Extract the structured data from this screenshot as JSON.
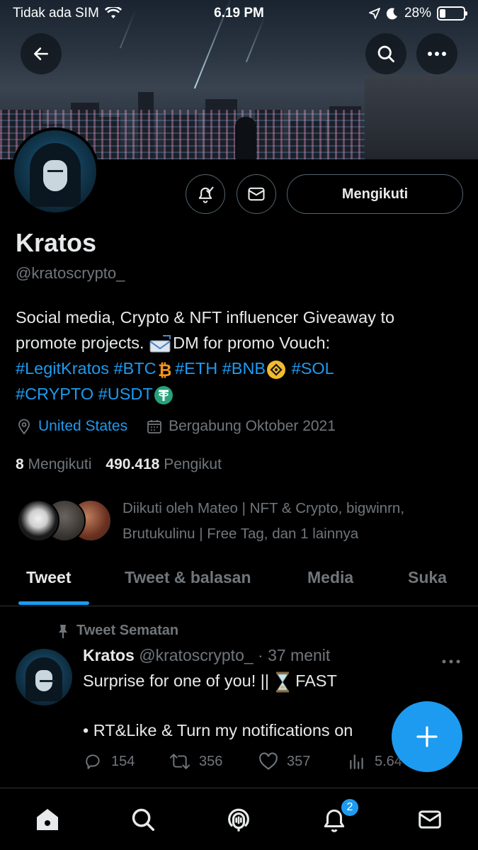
{
  "status_bar": {
    "carrier": "Tidak ada SIM",
    "time": "6.19 PM",
    "battery": "28%"
  },
  "profile": {
    "name": "Kratos",
    "handle": "@kratoscrypto_",
    "follow_button_label": "Mengikuti",
    "bio": {
      "line1": "Social media, Crypto & NFT influencer Giveaway to",
      "line2_text": "promote projects. ",
      "line2_rest": "DM for promo Vouch:",
      "tags_line3": [
        "#LegitKratos",
        "#BTC",
        "#ETH",
        "#BNB",
        "#SOL"
      ],
      "tags_line4": [
        "#CRYPTO",
        "#USDT"
      ]
    },
    "location": "United States",
    "joined": "Bergabung Oktober 2021",
    "following_count": "8",
    "following_label": "Mengikuti",
    "followers_count": "490.418",
    "followers_label": "Pengikut",
    "followed_by_line1": "Diikuti oleh Mateo | NFT & Crypto, bigwinrn,",
    "followed_by_line2": "Brutukulinu | Free Tag, dan 1 lainnya"
  },
  "tabs": [
    "Tweet",
    "Tweet & balasan",
    "Media",
    "Suka"
  ],
  "pinned_tweet": {
    "pinned_label": "Tweet Sematan",
    "author_name": "Kratos",
    "author_handle": "@kratoscrypto_",
    "time": "· 37 menit",
    "line1_a": "Surprise for one of you! ||",
    "line1_b": "FAST",
    "line2": "• RT&Like & Turn my notifications on",
    "replies": "154",
    "retweets": "356",
    "likes": "357",
    "views": "5.64"
  },
  "notifications_badge": "2",
  "colors": {
    "accent": "#1d9bf0",
    "background": "#000000",
    "text_primary": "#e7e9ea",
    "text_secondary": "#71767b"
  }
}
